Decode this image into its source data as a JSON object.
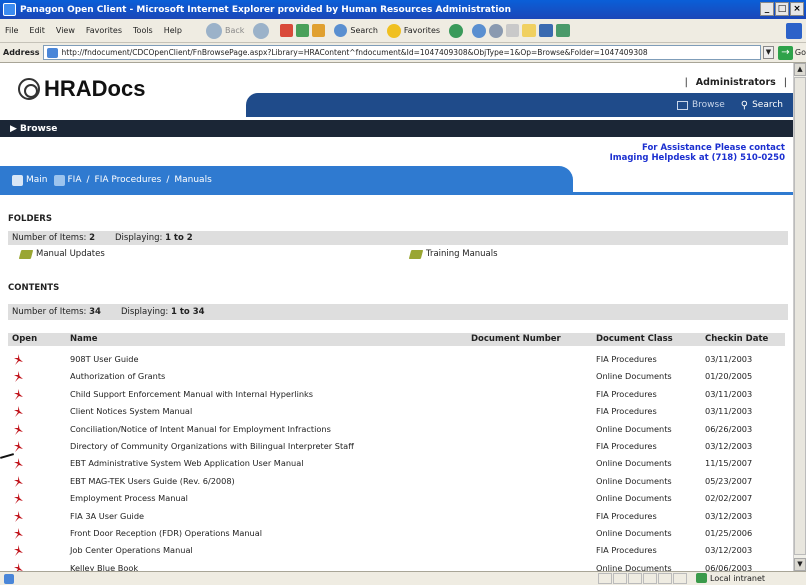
{
  "window": {
    "title": "Panagon Open Client - Microsoft Internet Explorer provided by Human Resources Administration"
  },
  "menu": [
    "File",
    "Edit",
    "View",
    "Favorites",
    "Tools",
    "Help"
  ],
  "toolbar": {
    "back": "Back",
    "search": "Search",
    "favorites": "Favorites"
  },
  "address": {
    "label": "Address",
    "url": "http://fndocument/CDCOpenClient/FnBrowsePage.aspx?Library=HRAContent^fndocument&Id=1047409308&ObjType=1&Op=Browse&Folder=1047409308",
    "go": "Go"
  },
  "header": {
    "logo_bold": "HRA",
    "logo_rest": "Docs",
    "admin_sep": "|",
    "admin": "Administrators",
    "admin_sep2": "|",
    "nav_browse": "Browse",
    "nav_search": "Search",
    "browse_bar": "▶ Browse",
    "assist_line1": "For Assistance Please contact",
    "assist_line2": "Imaging Helpdesk at (718) 510-0250"
  },
  "breadcrumb": {
    "main": "Main",
    "fia": "FIA",
    "sep": "/",
    "procedures": "FIA Procedures",
    "manuals": "Manuals"
  },
  "folders": {
    "title": "FOLDERS",
    "count_label": "Number of Items:",
    "count": "2",
    "display_label": "Displaying:",
    "display": "1 to 2",
    "items": [
      "Manual Updates",
      "Training Manuals"
    ]
  },
  "contents": {
    "title": "CONTENTS",
    "count_label": "Number of Items:",
    "count": "34",
    "display_label": "Displaying:",
    "display": "1 to 34"
  },
  "table": {
    "columns": [
      "Open",
      "Name",
      "Document Number",
      "Document Class",
      "Checkin Date"
    ],
    "rows": [
      {
        "name": "908T User Guide",
        "number": "",
        "class": "FIA Procedures",
        "date": "03/11/2003"
      },
      {
        "name": "Authorization of Grants",
        "number": "",
        "class": "Online Documents",
        "date": "01/20/2005"
      },
      {
        "name": "Child Support Enforcement Manual with Internal Hyperlinks",
        "number": "",
        "class": "FIA Procedures",
        "date": "03/11/2003"
      },
      {
        "name": "Client Notices System Manual",
        "number": "",
        "class": "FIA Procedures",
        "date": "03/11/2003"
      },
      {
        "name": "Conciliation/Notice of Intent Manual for Employment Infractions",
        "number": "",
        "class": "Online Documents",
        "date": "06/26/2003"
      },
      {
        "name": "Directory of Community Organizations with Bilingual Interpreter Staff",
        "number": "",
        "class": "FIA Procedures",
        "date": "03/12/2003"
      },
      {
        "name": "EBT Administrative System Web Application User Manual",
        "number": "",
        "class": "Online Documents",
        "date": "11/15/2007"
      },
      {
        "name": "EBT MAG-TEK Users Guide (Rev. 6/2008)",
        "number": "",
        "class": "Online Documents",
        "date": "05/23/2007"
      },
      {
        "name": "Employment Process Manual",
        "number": "",
        "class": "Online Documents",
        "date": "02/02/2007"
      },
      {
        "name": "FIA 3A User Guide",
        "number": "",
        "class": "FIA Procedures",
        "date": "03/12/2003"
      },
      {
        "name": "Front Door Reception (FDR) Operations Manual",
        "number": "",
        "class": "Online Documents",
        "date": "01/25/2006"
      },
      {
        "name": "Job Center Operations Manual",
        "number": "",
        "class": "FIA Procedures",
        "date": "03/12/2003"
      },
      {
        "name": "Kelley Blue Book",
        "number": "",
        "class": "Online Documents",
        "date": "06/06/2003"
      }
    ]
  },
  "status": {
    "zone": "Local intranet"
  },
  "colors": {
    "title_bar": "#1b47b8",
    "nav_bar": "#1f4b8a",
    "crumb_bar": "#2f7ad0",
    "browse_bar": "#1b2636",
    "pdf": "#c0121a",
    "link": "#1b2fd0"
  }
}
